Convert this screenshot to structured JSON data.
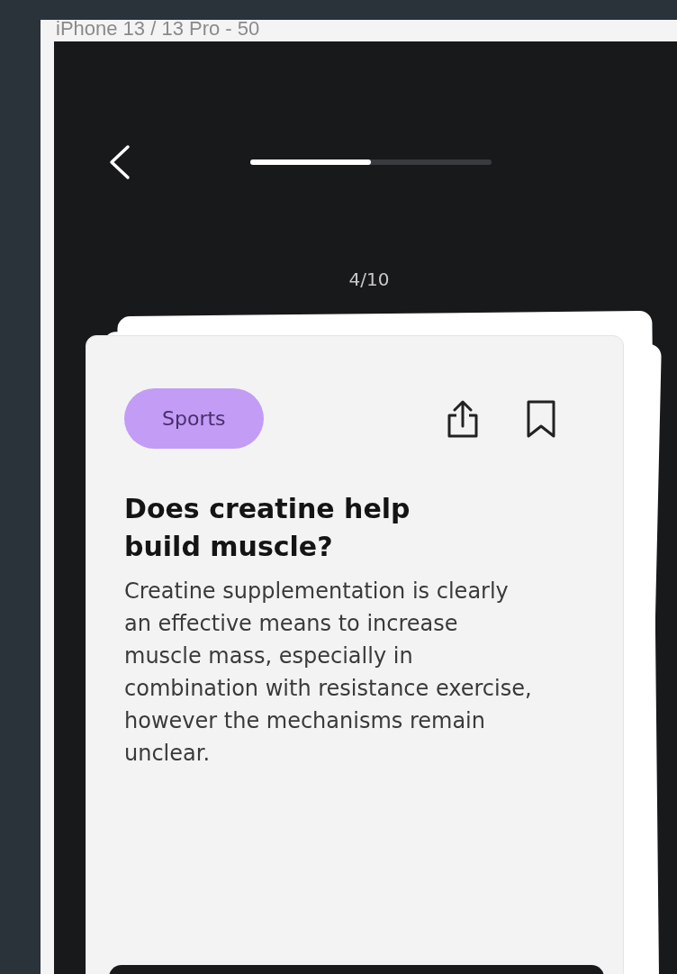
{
  "frame_label": "iPhone 13 / 13 Pro - 50",
  "progress": {
    "level": 0.5
  },
  "counter": "4/10",
  "card": {
    "tag": "Sports",
    "title": "Does creatine help build muscle?",
    "body": "Creatine supplementation is clearly an effective means to increase muscle mass, especially in combination with resistance exercise, however the mechanisms remain unclear."
  }
}
